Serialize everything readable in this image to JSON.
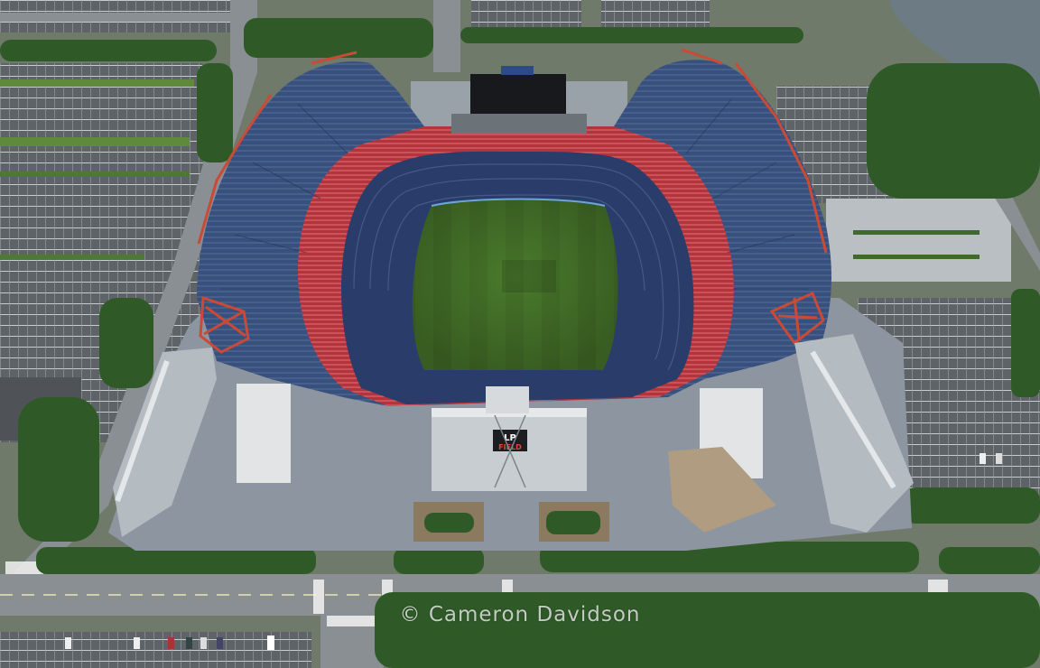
{
  "photo": {
    "subject": "aerial-stadium",
    "watermark": "© Cameron Davidson",
    "facade_sign_line1": "LP",
    "facade_sign_line2": "FIELD"
  },
  "palette": {
    "field": "#4a7a2c",
    "upper_deck": "#38507e",
    "lower_bowl": "#2a3d6a",
    "club_level": "#b3343b",
    "plaza": "#8d96a0",
    "parking": "#5b6064",
    "trees": "#2f5a28",
    "river": "#6d7c84",
    "truss": "#c94a36"
  }
}
